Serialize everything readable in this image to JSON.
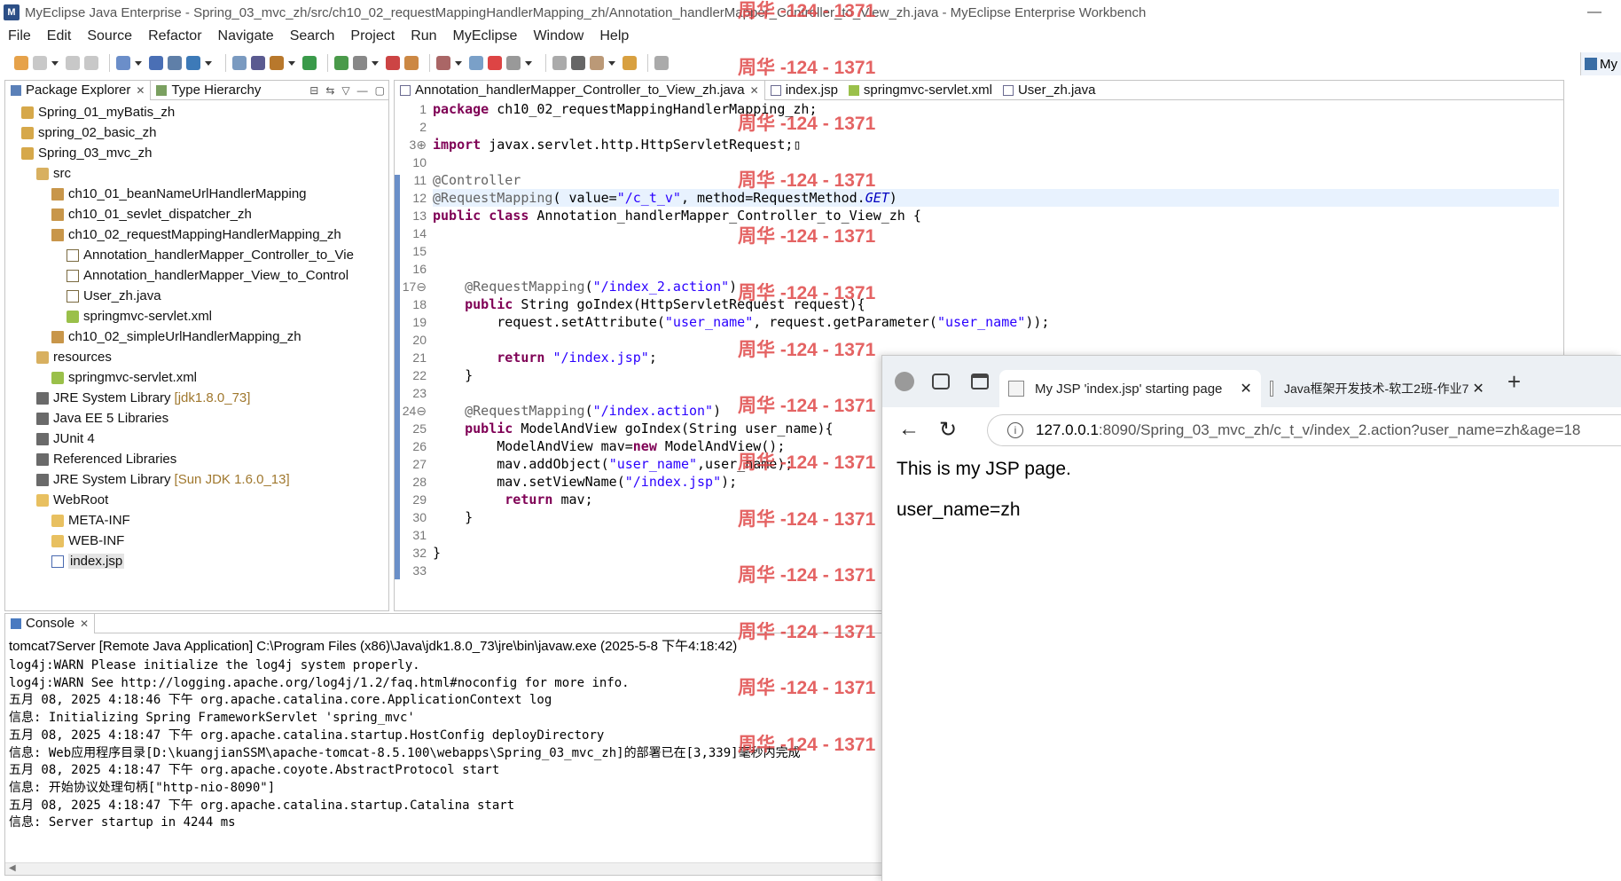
{
  "window": {
    "title": "MyEclipse Java Enterprise - Spring_03_mvc_zh/src/ch10_02_requestMappingHandlerMapping_zh/Annotation_handlerMapper_Controller_to_View_zh.java - MyEclipse Enterprise Workbench",
    "minimize": "—"
  },
  "menu": [
    "File",
    "Edit",
    "Source",
    "Refactor",
    "Navigate",
    "Search",
    "Project",
    "Run",
    "MyEclipse",
    "Window",
    "Help"
  ],
  "perspective_label": "My",
  "package_explorer": {
    "tabs": [
      "Package Explorer",
      "Type Hierarchy"
    ],
    "tree": [
      {
        "label": "Spring_01_myBatis_zh",
        "indent": 0,
        "icon": "project"
      },
      {
        "label": "spring_02_basic_zh",
        "indent": 0,
        "icon": "project"
      },
      {
        "label": "Spring_03_mvc_zh",
        "indent": 0,
        "icon": "project"
      },
      {
        "label": "src",
        "indent": 1,
        "icon": "srcfolder"
      },
      {
        "label": "ch10_01_beanNameUrlHandlerMapping",
        "indent": 2,
        "icon": "package"
      },
      {
        "label": "ch10_01_sevlet_dispatcher_zh",
        "indent": 2,
        "icon": "package"
      },
      {
        "label": "ch10_02_requestMappingHandlerMapping_zh",
        "indent": 2,
        "icon": "package"
      },
      {
        "label": "Annotation_handlerMapper_Controller_to_Vie",
        "indent": 3,
        "icon": "javafile"
      },
      {
        "label": "Annotation_handlerMapper_View_to_Control",
        "indent": 3,
        "icon": "javafile"
      },
      {
        "label": "User_zh.java",
        "indent": 3,
        "icon": "javafile"
      },
      {
        "label": "springmvc-servlet.xml",
        "indent": 3,
        "icon": "xml"
      },
      {
        "label": "ch10_02_simpleUrlHandlerMapping_zh",
        "indent": 2,
        "icon": "package"
      },
      {
        "label": "resources",
        "indent": 1,
        "icon": "srcfolder"
      },
      {
        "label": "springmvc-servlet.xml",
        "indent": 2,
        "icon": "xml"
      },
      {
        "label": "JRE System Library",
        "dim": "[jdk1.8.0_73]",
        "indent": 1,
        "icon": "library"
      },
      {
        "label": "Java EE 5 Libraries",
        "indent": 1,
        "icon": "library"
      },
      {
        "label": "JUnit 4",
        "indent": 1,
        "icon": "library"
      },
      {
        "label": "Referenced Libraries",
        "indent": 1,
        "icon": "library"
      },
      {
        "label": "JRE System Library",
        "dim": "[Sun JDK 1.6.0_13]",
        "indent": 1,
        "icon": "library"
      },
      {
        "label": "WebRoot",
        "indent": 1,
        "icon": "folder"
      },
      {
        "label": "META-INF",
        "indent": 2,
        "icon": "folder"
      },
      {
        "label": "WEB-INF",
        "indent": 2,
        "icon": "folder"
      },
      {
        "label": "index.jsp",
        "indent": 2,
        "icon": "jsp",
        "selected": true
      }
    ]
  },
  "editor": {
    "tabs": [
      "Annotation_handlerMapper_Controller_to_View_zh.java",
      "index.jsp",
      "springmvc-servlet.xml",
      "User_zh.java"
    ],
    "lines": [
      {
        "n": "1",
        "html": "<span class=\"kw\">package</span> ch10_02_requestMappingHandlerMapping_zh;"
      },
      {
        "n": "2",
        "html": ""
      },
      {
        "n": "3⊕",
        "html": "<span class=\"kw\">import</span> javax.servlet.http.HttpServletRequest;▯"
      },
      {
        "n": "10",
        "html": ""
      },
      {
        "n": "11",
        "html": "<span class=\"ann\">@Controller</span>"
      },
      {
        "n": "12",
        "html": "<span class=\"ann\">@RequestMapping</span>( value=<span class=\"str\">\"/c_t_v\"</span>, method=RequestMethod.<span class=\"it\">GET</span>)",
        "current": true
      },
      {
        "n": "13",
        "html": "<span class=\"kw\">public class</span> Annotation_handlerMapper_Controller_to_View_zh {"
      },
      {
        "n": "14",
        "html": ""
      },
      {
        "n": "15",
        "html": ""
      },
      {
        "n": "16",
        "html": ""
      },
      {
        "n": "17⊖",
        "html": "    <span class=\"ann\">@RequestMapping</span>(<span class=\"str\">\"/index_2.action\"</span>)"
      },
      {
        "n": "18",
        "html": "    <span class=\"kw\">public</span> String goIndex(HttpServletRequest request){"
      },
      {
        "n": "19",
        "html": "        request.setAttribute(<span class=\"str\">\"user_name\"</span>, request.getParameter(<span class=\"str\">\"user_name\"</span>));"
      },
      {
        "n": "20",
        "html": ""
      },
      {
        "n": "21",
        "html": "        <span class=\"kw\">return</span> <span class=\"str\">\"/index.jsp\"</span>;"
      },
      {
        "n": "22",
        "html": "    }"
      },
      {
        "n": "23",
        "html": ""
      },
      {
        "n": "24⊖",
        "html": "    <span class=\"ann\">@RequestMapping</span>(<span class=\"str\">\"/index.action\"</span>)"
      },
      {
        "n": "25",
        "html": "    <span class=\"kw\">public</span> ModelAndView goIndex(String user_name){"
      },
      {
        "n": "26",
        "html": "        ModelAndView mav=<span class=\"kw\">new</span> ModelAndView();"
      },
      {
        "n": "27",
        "html": "        mav.addObject(<span class=\"str\">\"user_name\"</span>,user_name);"
      },
      {
        "n": "28",
        "html": "        mav.setViewName(<span class=\"str\">\"/index.jsp\"</span>);"
      },
      {
        "n": "29",
        "html": "         <span class=\"kw\">return</span> mav;"
      },
      {
        "n": "30",
        "html": "    }"
      },
      {
        "n": "31",
        "html": ""
      },
      {
        "n": "32",
        "html": "}"
      },
      {
        "n": "33",
        "html": ""
      }
    ]
  },
  "console": {
    "tab": "Console",
    "header": "tomcat7Server [Remote Java Application] C:\\Program Files (x86)\\Java\\jdk1.8.0_73\\jre\\bin\\javaw.exe (2025-5-8 下午4:18:42)",
    "lines": [
      "log4j:WARN Please initialize the log4j system properly.",
      "log4j:WARN See http://logging.apache.org/log4j/1.2/faq.html#noconfig for more info.",
      "五月 08, 2025 4:18:46 下午 org.apache.catalina.core.ApplicationContext log",
      "信息: Initializing Spring FrameworkServlet 'spring_mvc'",
      "五月 08, 2025 4:18:47 下午 org.apache.catalina.startup.HostConfig deployDirectory",
      "信息: Web应用程序目录[D:\\kuangjianSSM\\apache-tomcat-8.5.100\\webapps\\Spring_03_mvc_zh]的部署已在[3,339]毫秒内完成",
      "五月 08, 2025 4:18:47 下午 org.apache.coyote.AbstractProtocol start",
      "信息: 开始协议处理句柄[\"http-nio-8090\"]",
      "五月 08, 2025 4:18:47 下午 org.apache.catalina.startup.Catalina start",
      "信息: Server startup in 4244 ms"
    ]
  },
  "browser": {
    "tabs": [
      {
        "label": "My JSP 'index.jsp' starting page",
        "active": true
      },
      {
        "label": "Java框架开发技术-软工2班-作业7",
        "active": false
      }
    ],
    "new_tab": "+",
    "url_host": "127.0.0.1",
    "url_rest": ":8090/Spring_03_mvc_zh/c_t_v/index_2.action?user_name=zh&age=18",
    "content": [
      "This is my JSP page.",
      "user_name=zh"
    ]
  },
  "watermark": "周华 -124 - 1371"
}
